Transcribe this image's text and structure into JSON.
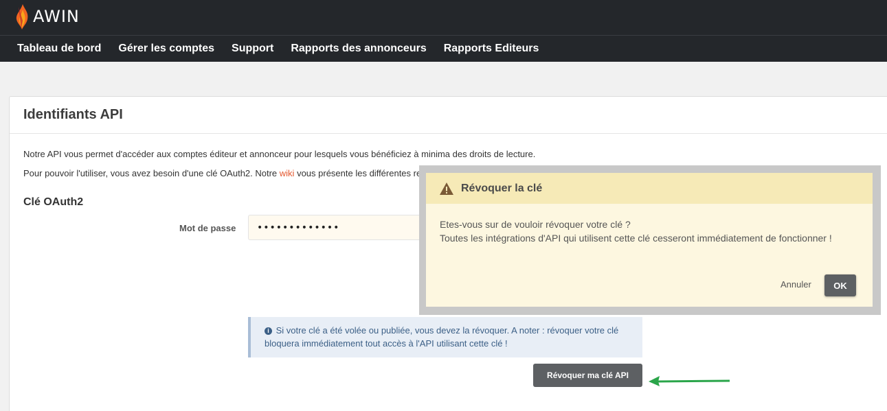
{
  "app": {
    "logo_text": "AWIN"
  },
  "nav": {
    "items": [
      "Tableau de bord",
      "Gérer les comptes",
      "Support",
      "Rapports des annonceurs",
      "Rapports Editeurs"
    ]
  },
  "page": {
    "title": "Identifiants API",
    "para1": "Notre API vous permet d'accéder aux comptes éditeur et annonceur pour lesquels vous bénéficiez à minima des droits de lecture.",
    "para2_before": "Pour pouvoir l'utiliser, vous avez besoin d'une clé OAuth2. Notre ",
    "para2_link": "wiki",
    "para2_after": " vous présente les différentes requêtes disponibles et comment les installer.",
    "section_title": "Clé OAuth2",
    "password_label": "Mot de passe",
    "password_value": "•••••••••••••",
    "info_text": "Si votre clé a été volée ou publiée, vous devez la révoquer. A noter : révoquer votre clé bloquera immédiatement tout accès à l'API utilisant cette clé !",
    "revoke_button": "Révoquer ma clé API"
  },
  "modal": {
    "title": "Révoquer la clé",
    "line1": "Etes-vous sur de vouloir révoquer votre clé ?",
    "line2": "Toutes les intégrations d'API qui utilisent cette clé cesseront immédiatement de fonctionner !",
    "cancel_label": "Annuler",
    "ok_label": "OK"
  },
  "colors": {
    "topbar": "#24272b",
    "link": "#e4572e",
    "modal_header": "#f6eab7",
    "modal_bg": "#fdf7e0",
    "button": "#5d6063",
    "arrow": "#2aa54a"
  },
  "icons": {
    "logo": "awin-flame-icon",
    "info": "info-circle-icon",
    "warning": "warning-triangle-icon",
    "annotation": "arrow-left-icon"
  }
}
